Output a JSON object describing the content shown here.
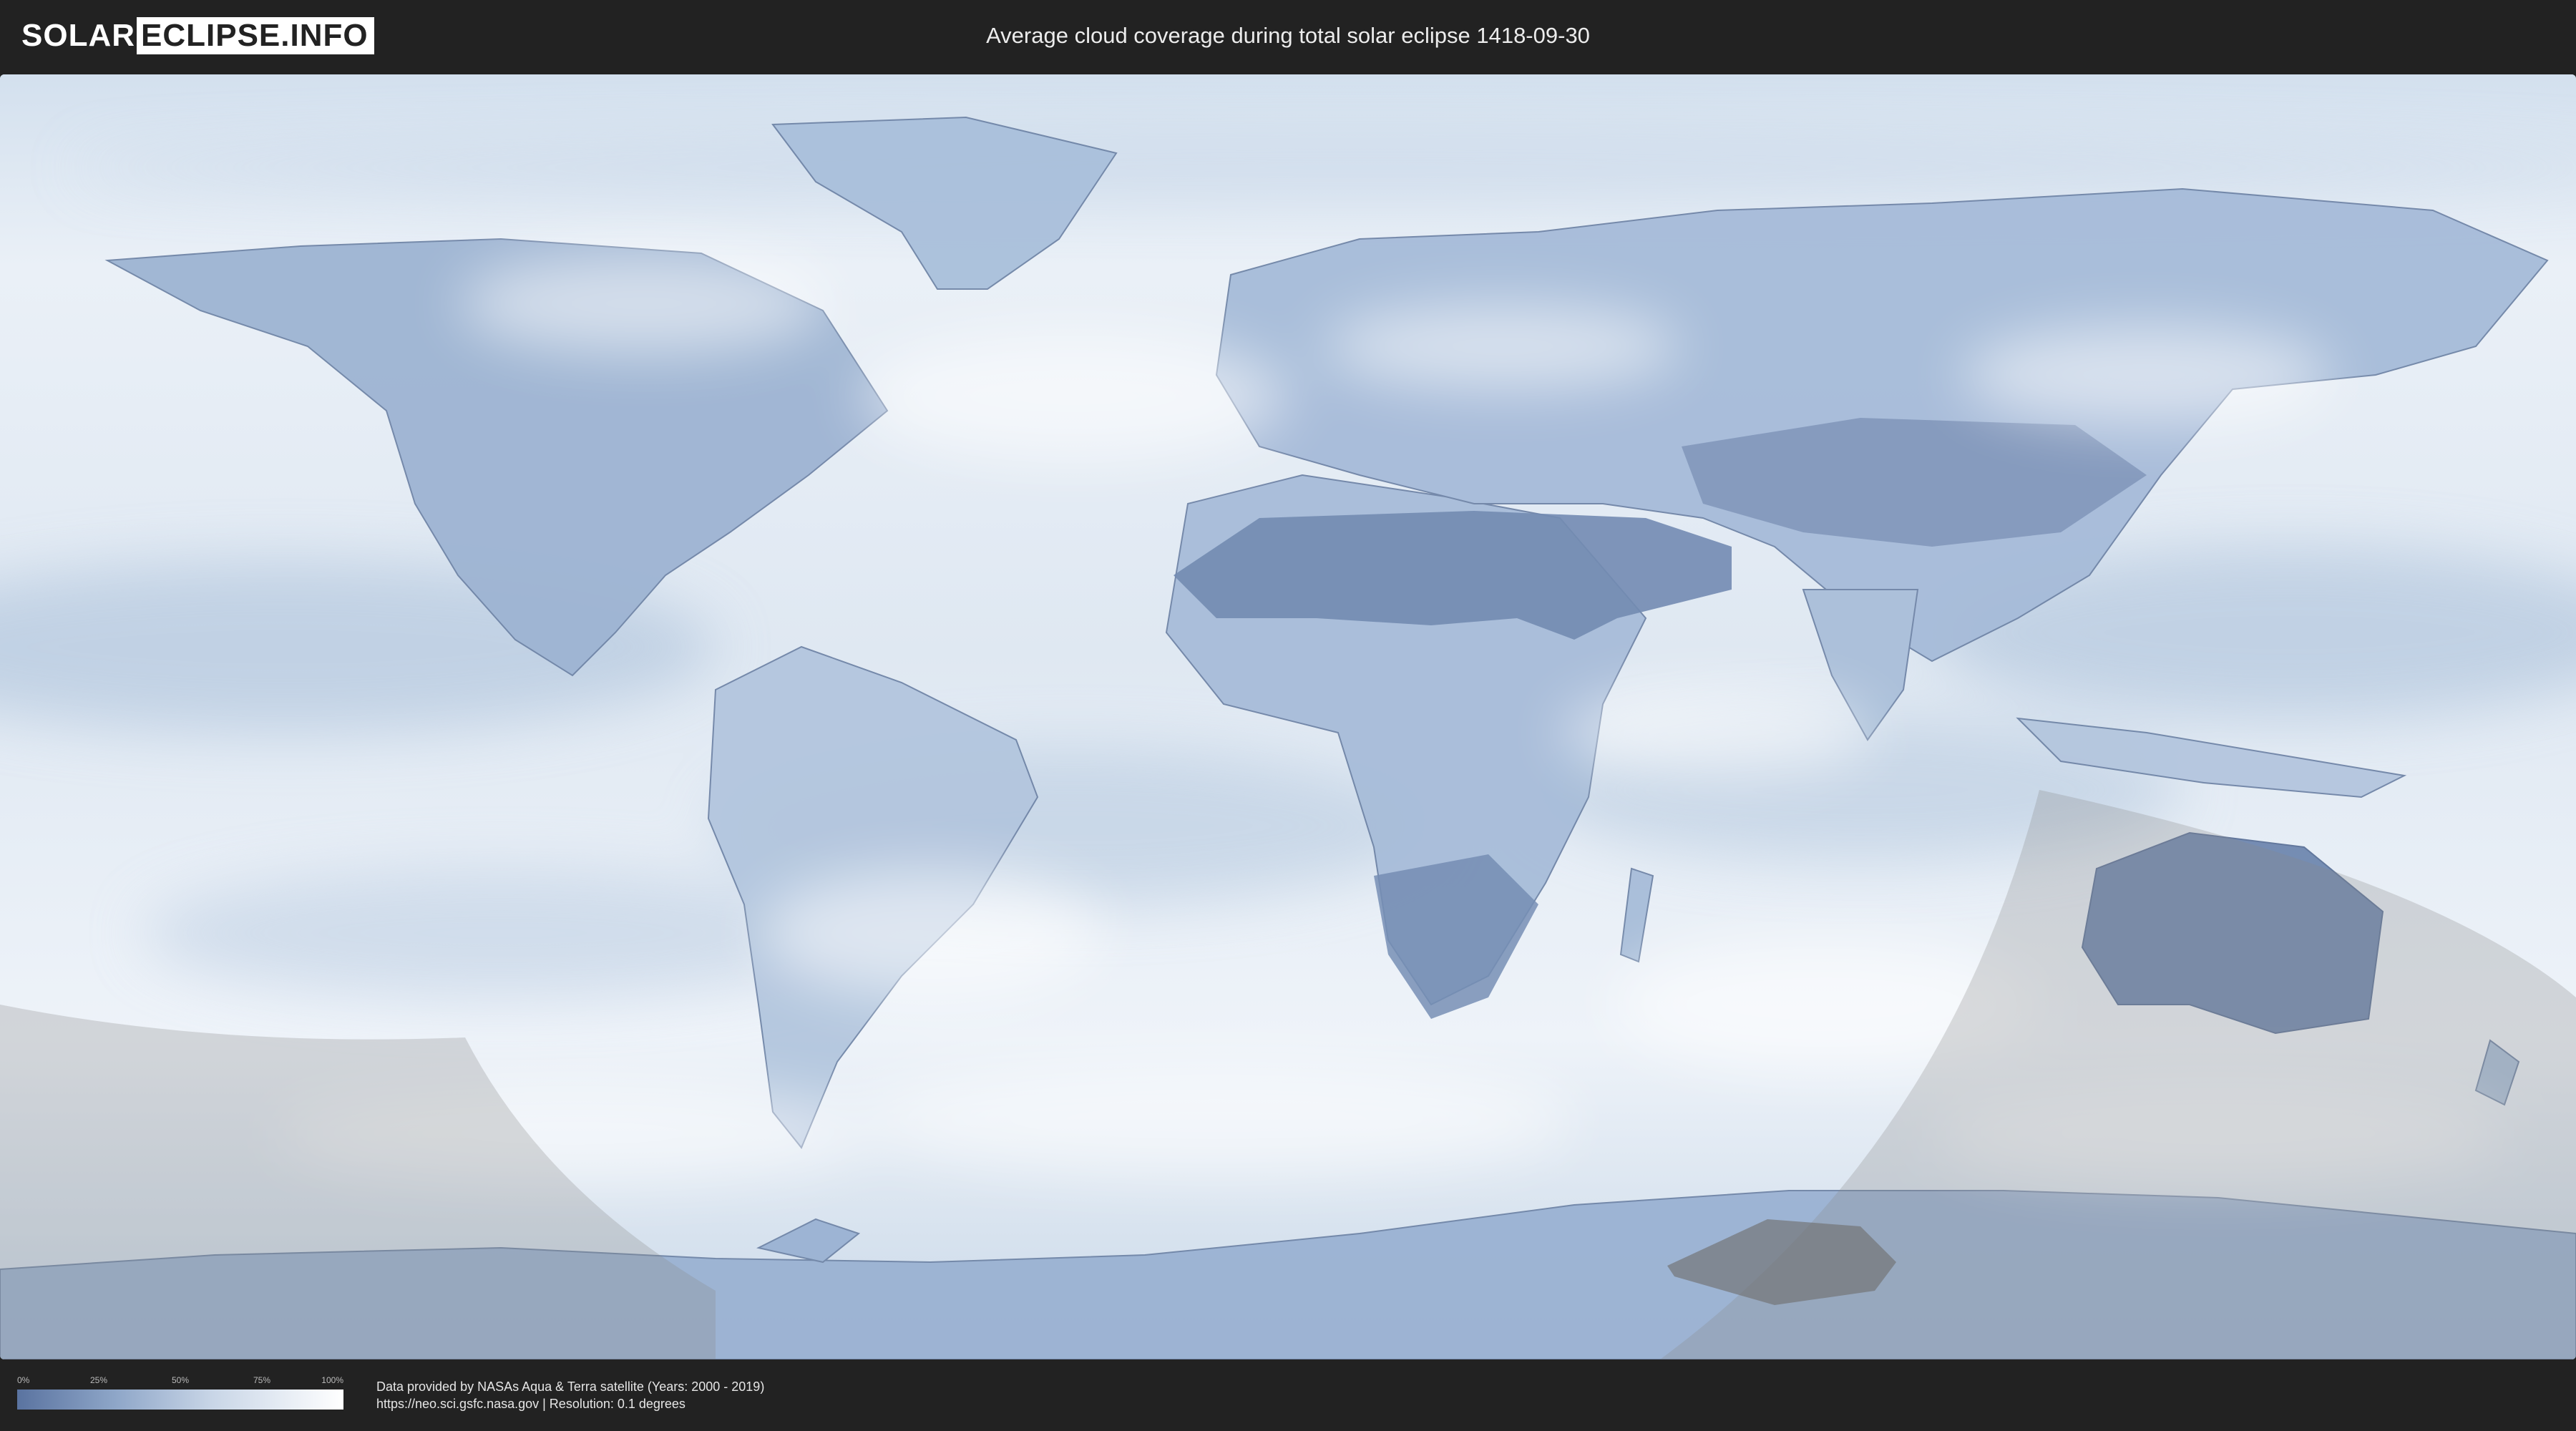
{
  "header": {
    "logo_left": "SOLAR",
    "logo_right": "ECLIPSE.INFO",
    "title": "Average cloud coverage during total solar eclipse 1418-09-30"
  },
  "map": {
    "type": "world cloud coverage map",
    "colors": {
      "clear_sky": "#5a73a0",
      "full_cloud": "#ffffff",
      "eclipse_shadow": "#8a8a8a"
    }
  },
  "legend": {
    "ticks": [
      "0%",
      "25%",
      "50%",
      "75%",
      "100%"
    ]
  },
  "footer": {
    "line1": "Data provided by NASAs Aqua & Terra satellite (Years: 2000 - 2019)",
    "line2": "https://neo.sci.gsfc.nasa.gov | Resolution: 0.1 degrees"
  }
}
